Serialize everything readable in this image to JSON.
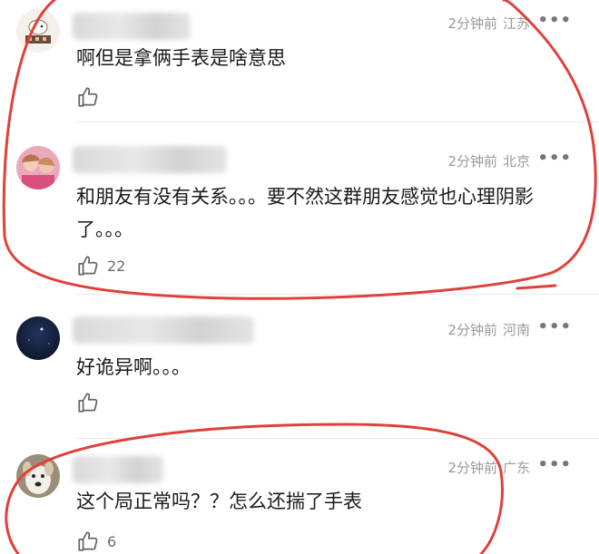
{
  "comments": [
    {
      "time": "2分钟前",
      "location": "江苏",
      "text": "啊但是拿俩手表是啥意思",
      "likes": ""
    },
    {
      "time": "2分钟前",
      "location": "北京",
      "text": "和朋友有没有关系。。。要不然这群朋友感觉也心理阴影了。。。",
      "likes": "22"
    },
    {
      "time": "2分钟前",
      "location": "河南",
      "text": "好诡异啊。。。",
      "likes": ""
    },
    {
      "time": "2分钟前",
      "location": "广东",
      "text": "这个局正常吗？？怎么还揣了手表",
      "likes": "6"
    }
  ],
  "more_glyph": "•••",
  "annotation_color": "#e0403a"
}
